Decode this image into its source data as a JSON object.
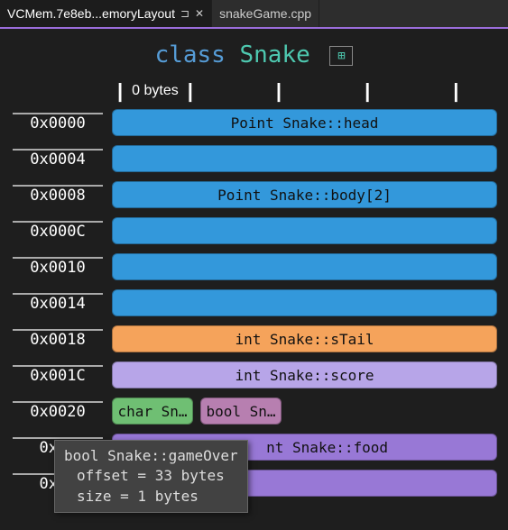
{
  "tabs": {
    "active": {
      "label": "VCMem.7e8eb...emoryLayout"
    },
    "other": {
      "label": "snakeGame.cpp"
    }
  },
  "header": {
    "keyword": "class",
    "name": "Snake"
  },
  "ruler": {
    "zero": "0 bytes"
  },
  "rows": [
    {
      "offset": "0x0000",
      "bars": [
        {
          "color": "blue",
          "label": "Point Snake::head"
        }
      ]
    },
    {
      "offset": "0x0004",
      "bars": [
        {
          "color": "blue",
          "label": ""
        }
      ]
    },
    {
      "offset": "0x0008",
      "bars": [
        {
          "color": "blue",
          "label": "Point Snake::body[2]"
        }
      ]
    },
    {
      "offset": "0x000C",
      "bars": [
        {
          "color": "blue",
          "label": ""
        }
      ]
    },
    {
      "offset": "0x0010",
      "bars": [
        {
          "color": "blue",
          "label": ""
        }
      ]
    },
    {
      "offset": "0x0014",
      "bars": [
        {
          "color": "blue",
          "label": ""
        }
      ]
    },
    {
      "offset": "0x0018",
      "bars": [
        {
          "color": "orange",
          "label": "int Snake::sTail"
        }
      ]
    },
    {
      "offset": "0x001C",
      "bars": [
        {
          "color": "lav",
          "label": "int Snake::score"
        }
      ]
    },
    {
      "offset": "0x0020",
      "bars": [
        {
          "color": "green",
          "label": "char Sn…",
          "small": true
        },
        {
          "color": "plum",
          "label": "bool Sn…",
          "small": true
        }
      ]
    },
    {
      "offset": "0x00",
      "bars": [
        {
          "color": "violet",
          "label": "nt Snake::food",
          "partial": true
        }
      ]
    },
    {
      "offset": "0x00",
      "bars": [
        {
          "color": "violet",
          "label": ""
        }
      ]
    }
  ],
  "tooltip": {
    "line1": "bool Snake::gameOver",
    "line2": "offset = 33 bytes",
    "line3": "size = 1 bytes"
  }
}
